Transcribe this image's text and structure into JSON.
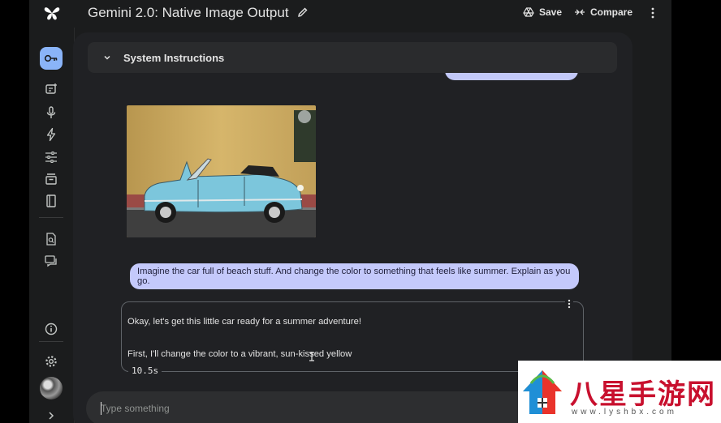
{
  "header": {
    "title": "Gemini 2.0: Native Image Output",
    "save_label": "Save",
    "compare_label": "Compare"
  },
  "system_instructions": {
    "label": "System Instructions"
  },
  "chat": {
    "user_message": "Imagine the car full of beach stuff. And change the color to something that feels like summer. Explain as you go.",
    "response_lines": [
      "Okay, let's get this little car ready for a summer adventure!",
      "First, I'll change the color to a vibrant, sun-kissed yellow"
    ],
    "timer": "10.5s"
  },
  "input": {
    "placeholder": "Type something"
  },
  "watermark": {
    "title": "八星手游网",
    "url": "www.lyshbx.com"
  },
  "colors": {
    "accent": "#8ab4f8",
    "user_bubble": "#c4c9fb",
    "car_body": "#7cc6dc",
    "wall": "#d4b46a"
  }
}
